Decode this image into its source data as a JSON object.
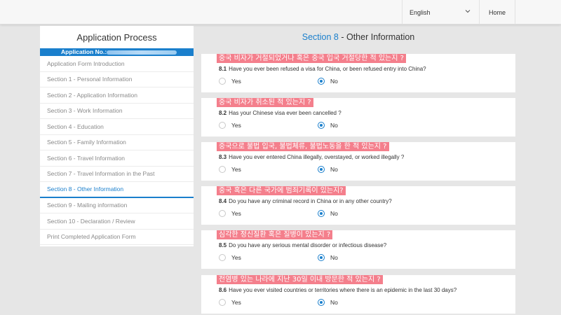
{
  "topbar": {
    "language": "English",
    "home": "Home"
  },
  "sidebar": {
    "title": "Application Process",
    "application_no_label": "Application No.:",
    "items": [
      {
        "label": "Application Form Introduction",
        "active": false
      },
      {
        "label": "Section 1 - Personal Information",
        "active": false
      },
      {
        "label": "Section 2 - Application Information",
        "active": false
      },
      {
        "label": "Section 3 - Work Information",
        "active": false
      },
      {
        "label": "Section 4 - Education",
        "active": false
      },
      {
        "label": "Section 5 - Family Information",
        "active": false
      },
      {
        "label": "Section 6 - Travel Information",
        "active": false
      },
      {
        "label": "Section 7 - Travel Information in the Past",
        "active": false
      },
      {
        "label": "Section 8 - Other Information",
        "active": true
      },
      {
        "label": "Section 9 - Mailing information",
        "active": false
      },
      {
        "label": "Section 10 - Declaration / Review",
        "active": false
      },
      {
        "label": "Print Completed Application Form",
        "active": false
      }
    ]
  },
  "main": {
    "section_label": "Section 8",
    "section_title": " - Other Information",
    "yes_label": "Yes",
    "no_label": "No",
    "questions": [
      {
        "number": "8.1",
        "korean": "중국 비자가 거절되었거나 혹은 중국 입국 거절당한 적 있는지 ?",
        "text": "Have you ever been refused a visa for China, or been refused entry into China?",
        "answer": "No"
      },
      {
        "number": "8.2",
        "korean": "중국 비자가 취소된 적 있는지 ?",
        "text": "Has your Chinese visa ever been cancelled ?",
        "answer": "No"
      },
      {
        "number": "8.3",
        "korean": "중국으로 불법 입국, 불법체류, 불법노동을 한 적 있는지 ?",
        "text": "Have you ever entered China illegally, overstayed, or worked illegally ?",
        "answer": "No"
      },
      {
        "number": "8.4",
        "korean": "중국 혹은 다른 국가에 범죄기록이 있는지?",
        "text": "Do you have any criminal record in China or in any other country?",
        "answer": "No"
      },
      {
        "number": "8.5",
        "korean": "심각한 정신질환 혹은 질병이 있는지 ?",
        "text": "Do you have any serious mental disorder or infectious disease?",
        "answer": "No"
      },
      {
        "number": "8.6",
        "korean": "전염병 있는 나라에 지난 30일 이내 방문한 적 있는지 ?",
        "text": "Have you ever visited countries or territories where there is an epidemic in the last 30 days?",
        "answer": "No"
      }
    ]
  }
}
